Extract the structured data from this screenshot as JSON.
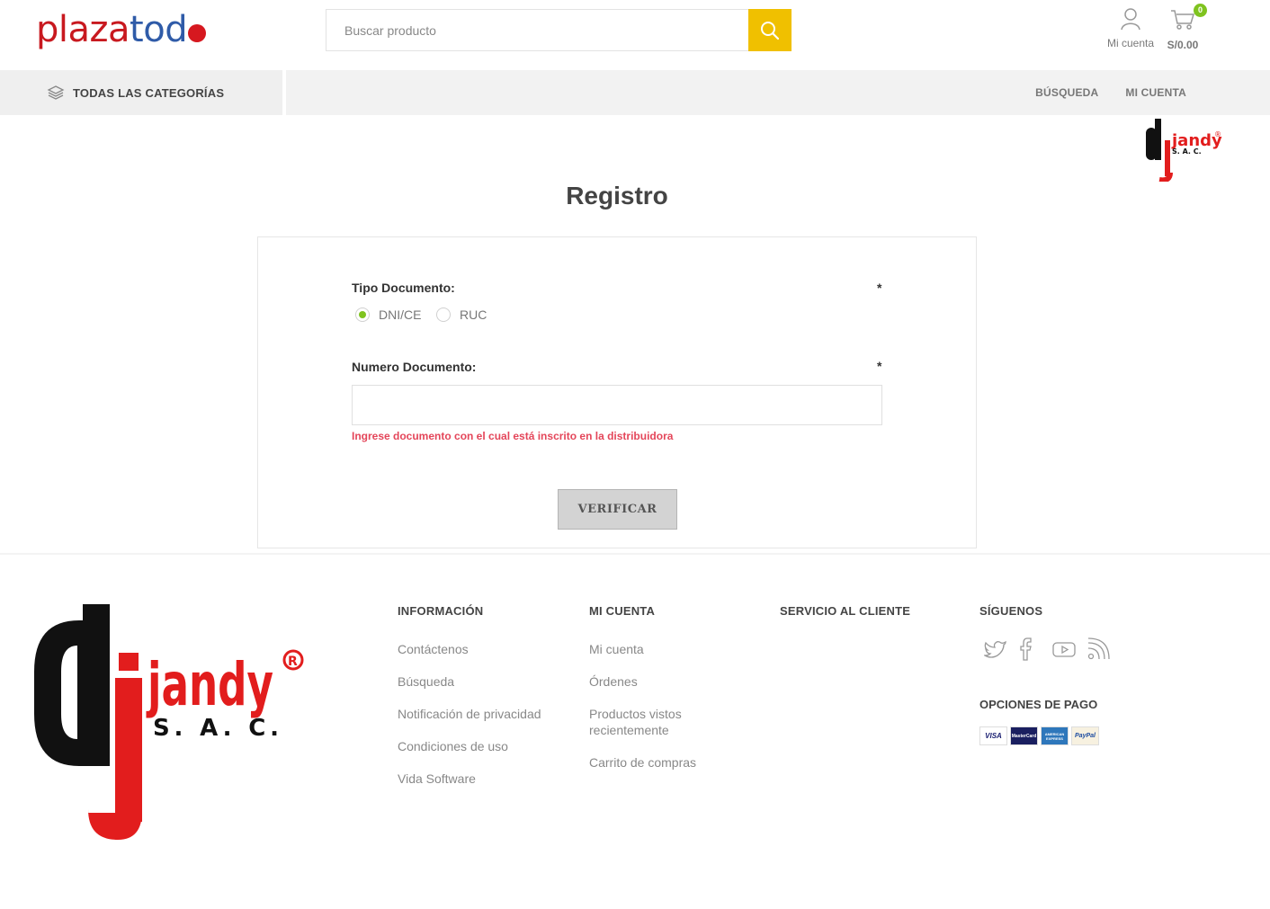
{
  "brand": {
    "part1": "plaza",
    "part2": "tod"
  },
  "search": {
    "placeholder": "Buscar producto"
  },
  "header": {
    "account_label": "Mi cuenta",
    "cart_count": "0",
    "cart_total": "S/0.00"
  },
  "nav": {
    "all_categories": "TODAS LAS CATEGORÍAS",
    "links": [
      "BÚSQUEDA",
      "MI CUENTA"
    ]
  },
  "page": {
    "title": "Registro"
  },
  "form": {
    "doc_type_label": "Tipo Documento:",
    "required_mark": "*",
    "options": [
      "DNI/CE",
      "RUC"
    ],
    "selected_option": "DNI/CE",
    "doc_number_label": "Numero Documento:",
    "doc_number_value": "",
    "hint": "Ingrese documento con el cual está inscrito en la distribuidora",
    "verify_label": "VERIFICAR"
  },
  "logo_text": {
    "brand": "jandy",
    "suffix": "S. A. C.",
    "reg": "®"
  },
  "footer": {
    "info": {
      "title": "INFORMACIÓN",
      "links": [
        "Contáctenos",
        "Búsqueda",
        "Notificación de privacidad",
        "Condiciones de uso",
        "Vida Software"
      ]
    },
    "account": {
      "title": "MI CUENTA",
      "links": [
        "Mi cuenta",
        "Órdenes",
        "Productos vistos recientemente",
        "Carrito de compras"
      ]
    },
    "service": {
      "title": "SERVICIO AL CLIENTE"
    },
    "follow": {
      "title": "SÍGUENOS",
      "icons": [
        "twitter-icon",
        "facebook-icon",
        "youtube-icon",
        "rss-icon"
      ]
    },
    "payment": {
      "title": "OPCIONES DE PAGO",
      "methods": [
        "VISA",
        "MasterCard",
        "AMERICAN EXPRESS",
        "PayPal"
      ]
    }
  },
  "colors": {
    "accent_yellow": "#f0c000",
    "brand_red": "#c8191f",
    "brand_blue": "#2f5ba8",
    "radio_green": "#7fc31f",
    "hint_red": "#e4465a"
  }
}
